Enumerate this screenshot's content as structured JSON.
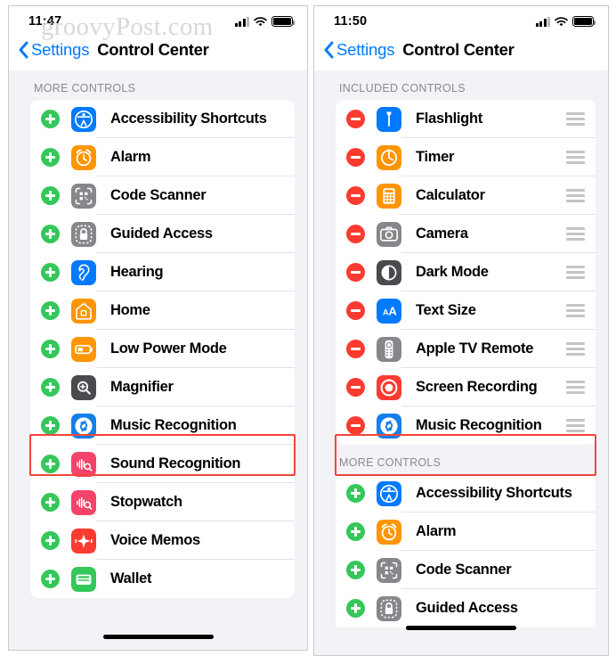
{
  "watermark": "groovyPost.com",
  "phones": [
    {
      "id": "left",
      "status": {
        "time": "11:47",
        "signal_icon": "cellular-signal-icon",
        "wifi_icon": "wifi-icon",
        "battery_icon": "battery-full-icon"
      },
      "nav": {
        "back_label": "Settings",
        "back_icon": "chevron-left-icon",
        "title": "Control Center"
      },
      "sections": [
        {
          "header": "MORE CONTROLS",
          "rows": [
            {
              "label": "Accessibility Shortcuts",
              "toggle": "add",
              "toggle_icon": "plus-circle-icon",
              "icon": "accessibility-icon",
              "handle": false
            },
            {
              "label": "Alarm",
              "toggle": "add",
              "toggle_icon": "plus-circle-icon",
              "icon": "alarm-clock-icon",
              "handle": false
            },
            {
              "label": "Code Scanner",
              "toggle": "add",
              "toggle_icon": "plus-circle-icon",
              "icon": "qr-code-scanner-icon",
              "handle": false
            },
            {
              "label": "Guided Access",
              "toggle": "add",
              "toggle_icon": "plus-circle-icon",
              "icon": "lock-icon",
              "handle": false
            },
            {
              "label": "Hearing",
              "toggle": "add",
              "toggle_icon": "plus-circle-icon",
              "icon": "ear-icon",
              "handle": false
            },
            {
              "label": "Home",
              "toggle": "add",
              "toggle_icon": "plus-circle-icon",
              "icon": "house-icon",
              "handle": false
            },
            {
              "label": "Low Power Mode",
              "toggle": "add",
              "toggle_icon": "plus-circle-icon",
              "icon": "battery-icon",
              "handle": false
            },
            {
              "label": "Magnifier",
              "toggle": "add",
              "toggle_icon": "plus-circle-icon",
              "icon": "magnifier-icon",
              "handle": false
            },
            {
              "label": "Music Recognition",
              "toggle": "add",
              "toggle_icon": "plus-circle-icon",
              "icon": "shazam-icon",
              "handle": false,
              "highlighted": true
            },
            {
              "label": "Sound Recognition",
              "toggle": "add",
              "toggle_icon": "plus-circle-icon",
              "icon": "waveform-magnifier-icon",
              "handle": false
            },
            {
              "label": "Stopwatch",
              "toggle": "add",
              "toggle_icon": "plus-circle-icon",
              "icon": "waveform-magnifier-icon",
              "handle": false
            },
            {
              "label": "Voice Memos",
              "toggle": "add",
              "toggle_icon": "plus-circle-icon",
              "icon": "voice-memos-icon",
              "handle": false
            },
            {
              "label": "Wallet",
              "toggle": "add",
              "toggle_icon": "plus-circle-icon",
              "icon": "wallet-icon",
              "handle": false
            }
          ]
        }
      ]
    },
    {
      "id": "right",
      "status": {
        "time": "11:50",
        "signal_icon": "cellular-signal-icon",
        "wifi_icon": "wifi-icon",
        "battery_icon": "battery-full-icon"
      },
      "nav": {
        "back_label": "Settings",
        "back_icon": "chevron-left-icon",
        "title": "Control Center"
      },
      "sections": [
        {
          "header": "INCLUDED CONTROLS",
          "rows": [
            {
              "label": "Flashlight",
              "toggle": "remove",
              "toggle_icon": "minus-circle-icon",
              "icon": "flashlight-icon",
              "handle": true
            },
            {
              "label": "Timer",
              "toggle": "remove",
              "toggle_icon": "minus-circle-icon",
              "icon": "timer-icon",
              "handle": true
            },
            {
              "label": "Calculator",
              "toggle": "remove",
              "toggle_icon": "minus-circle-icon",
              "icon": "calculator-icon",
              "handle": true
            },
            {
              "label": "Camera",
              "toggle": "remove",
              "toggle_icon": "minus-circle-icon",
              "icon": "camera-icon",
              "handle": true
            },
            {
              "label": "Dark Mode",
              "toggle": "remove",
              "toggle_icon": "minus-circle-icon",
              "icon": "dark-mode-icon",
              "handle": true
            },
            {
              "label": "Text Size",
              "toggle": "remove",
              "toggle_icon": "minus-circle-icon",
              "icon": "text-size-icon",
              "handle": true
            },
            {
              "label": "Apple TV Remote",
              "toggle": "remove",
              "toggle_icon": "minus-circle-icon",
              "icon": "tv-remote-icon",
              "handle": true
            },
            {
              "label": "Screen Recording",
              "toggle": "remove",
              "toggle_icon": "minus-circle-icon",
              "icon": "screen-recording-icon",
              "handle": true
            },
            {
              "label": "Music Recognition",
              "toggle": "remove",
              "toggle_icon": "minus-circle-icon",
              "icon": "shazam-icon",
              "handle": true,
              "highlighted": true
            }
          ]
        },
        {
          "header": "MORE CONTROLS",
          "rows": [
            {
              "label": "Accessibility Shortcuts",
              "toggle": "add",
              "toggle_icon": "plus-circle-icon",
              "icon": "accessibility-icon",
              "handle": false
            },
            {
              "label": "Alarm",
              "toggle": "add",
              "toggle_icon": "plus-circle-icon",
              "icon": "alarm-clock-icon",
              "handle": false
            },
            {
              "label": "Code Scanner",
              "toggle": "add",
              "toggle_icon": "plus-circle-icon",
              "icon": "qr-code-scanner-icon",
              "handle": false
            },
            {
              "label": "Guided Access",
              "toggle": "add",
              "toggle_icon": "plus-circle-icon",
              "icon": "lock-icon",
              "handle": false
            }
          ]
        }
      ]
    }
  ],
  "colors": {
    "accent_blue": "#007aff",
    "add_green": "#34c759",
    "remove_red": "#fc3b30",
    "highlight_red": "#f4453a",
    "page_bg": "#f2f2f7"
  }
}
